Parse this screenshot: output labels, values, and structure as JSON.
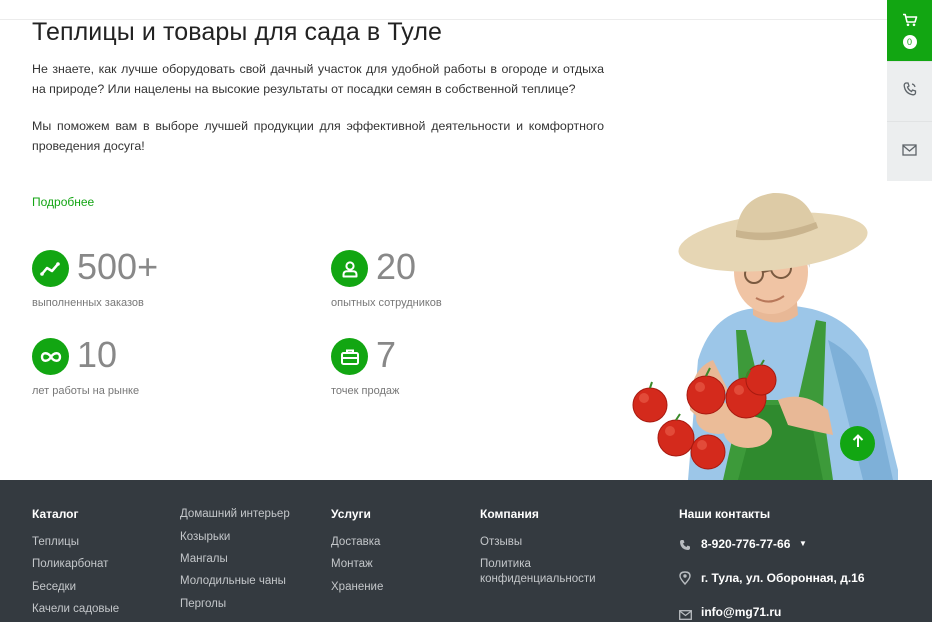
{
  "hero": {
    "title": "Теплицы и товары для сада в Туле",
    "paragraph1": "Не знаете, как лучше оборудовать свой дачный участок для удобной работы в огороде и отдыха на природе? Или нацелены на высокие результаты от посадки семян в собственной теплице?",
    "paragraph2": "Мы поможем вам в выборе лучшей продукции для эффективной деятельности и комфортного проведения досуга!",
    "more_link": "Подробнее"
  },
  "stats": [
    {
      "icon": "chart-line-icon",
      "value": "500+",
      "label": "выполненных заказов"
    },
    {
      "icon": "user-icon",
      "value": "20",
      "label": "опытных сотрудников"
    },
    {
      "icon": "infinity-icon",
      "value": "10",
      "label": "лет работы на рынке"
    },
    {
      "icon": "briefcase-icon",
      "value": "7",
      "label": "точек продаж"
    }
  ],
  "side_panel": {
    "cart_count": "0",
    "accent_color": "#12a612"
  },
  "footer": {
    "catalog": {
      "heading": "Каталог",
      "items": [
        "Теплицы",
        "Поликарбонат",
        "Беседки",
        "Качели садовые"
      ],
      "items_col2": [
        "Домашний интерьер",
        "Козырьки",
        "Мангалы",
        "Молодильные чаны",
        "Перголы"
      ]
    },
    "services": {
      "heading": "Услуги",
      "items": [
        "Доставка",
        "Монтаж",
        "Хранение"
      ]
    },
    "company": {
      "heading": "Компания",
      "items": [
        "Отзывы",
        "Политика конфиденциальности"
      ]
    },
    "contacts": {
      "heading": "Наши контакты",
      "phone": "8-920-776-77-66",
      "address": "г. Тула, ул. Оборонная, д.16",
      "email": "info@mg71.ru"
    },
    "background_color": "#343a40"
  }
}
